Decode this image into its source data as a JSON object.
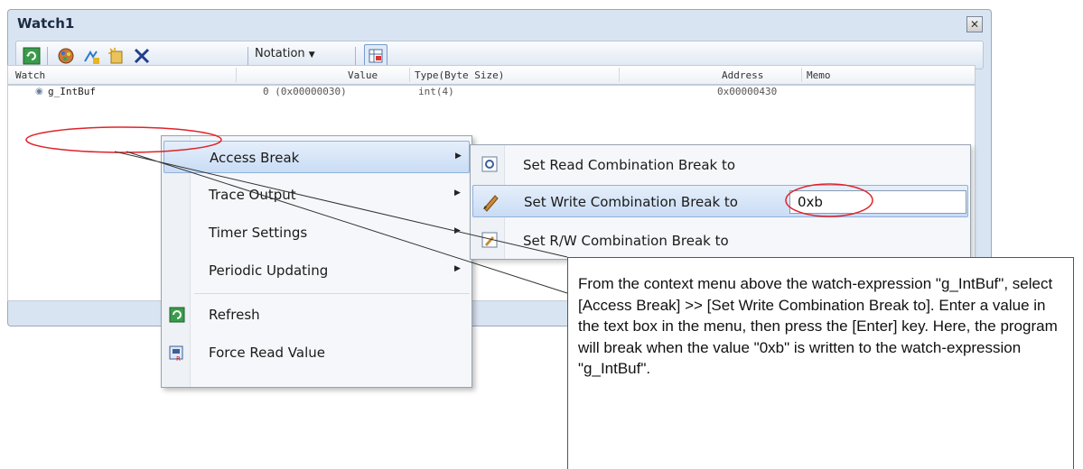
{
  "window": {
    "title": "Watch1"
  },
  "toolbar": {
    "notation_label": "Notation"
  },
  "columns": [
    "Watch",
    "Value",
    "Type(Byte Size)",
    "Address",
    "Memo"
  ],
  "watch_rows": [
    {
      "name": "g_IntBuf",
      "value": "0  (0x00000030)",
      "type": "int(4)",
      "address": "0x00000430",
      "memo": ""
    }
  ],
  "context_menu": {
    "items": [
      {
        "label": "Access Break",
        "has_submenu": true,
        "highlighted": true
      },
      {
        "label": "Trace Output",
        "has_submenu": true
      },
      {
        "label": "Timer Settings",
        "has_submenu": true
      },
      {
        "label": "Periodic Updating",
        "has_submenu": true
      },
      {
        "label": "Refresh",
        "icon": "refresh-icon"
      },
      {
        "label": "Force Read Value",
        "icon": "force-read-icon"
      }
    ]
  },
  "submenu": {
    "items": [
      {
        "label": "Set Read Combination Break to",
        "icon": "read-break-icon"
      },
      {
        "label": "Set Write Combination Break to",
        "icon": "write-break-icon",
        "highlighted": true,
        "input_value": "0xb"
      },
      {
        "label": "Set R/W Combination Break to",
        "icon": "rw-break-icon"
      }
    ]
  },
  "callout": {
    "text": "From the context menu above the watch-expression \"g_IntBuf\", select [Access Break] >> [Set Write Combination Break to].  Enter a value in the text box in the menu, then press the [Enter] key. Here, the program will break when the value \"0xb\" is written to the watch-expression \"g_IntBuf\"."
  },
  "colors": {
    "highlight_circle": "#e0232a",
    "menu_highlight": "#c9dcf4",
    "window_bg": "#d9e4f2"
  }
}
